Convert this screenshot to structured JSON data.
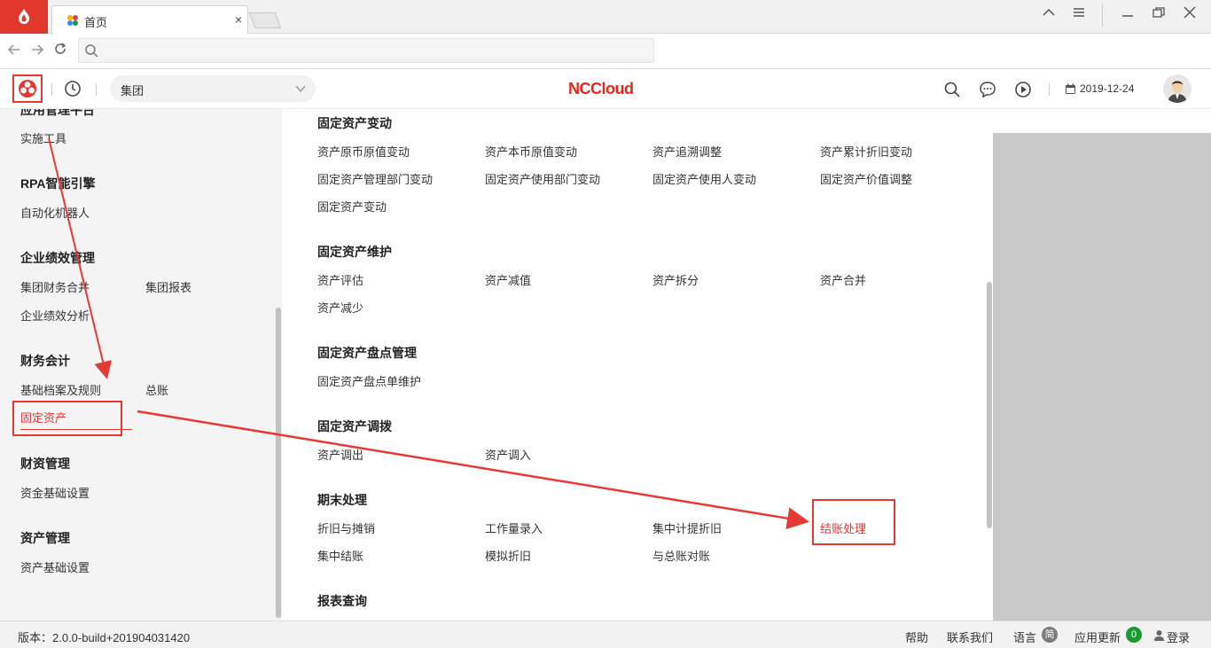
{
  "browser": {
    "tab_title": "首页",
    "tab_close": "×",
    "window_controls": [
      "▲",
      "≡",
      "—",
      "❐",
      "✕"
    ]
  },
  "header": {
    "group_selector": "集团",
    "brand": "NCCloud",
    "date": "2019-12-24"
  },
  "left_menu": {
    "categories": [
      {
        "title": "应用管理平台",
        "items": [
          "实施工具"
        ]
      },
      {
        "title": "RPA智能引擎",
        "items": [
          "自动化机器人"
        ]
      },
      {
        "title": "企业绩效管理",
        "items": [
          "集团财务合并",
          "集团报表",
          "企业绩效分析"
        ]
      },
      {
        "title": "财务会计",
        "items": [
          "基础档案及规则",
          "总账",
          "固定资产"
        ]
      },
      {
        "title": "财资管理",
        "items": [
          "资金基础设置"
        ]
      },
      {
        "title": "资产管理",
        "items": [
          "资产基础设置"
        ]
      }
    ],
    "active_item": "固定资产"
  },
  "main": {
    "sections": [
      {
        "title": "固定资产变动",
        "items": [
          "资产原币原值变动",
          "资产本币原值变动",
          "资产追溯调整",
          "资产累计折旧变动",
          "固定资产管理部门变动",
          "固定资产使用部门变动",
          "固定资产使用人变动",
          "固定资产价值调整",
          "固定资产变动"
        ]
      },
      {
        "title": "固定资产维护",
        "items": [
          "资产评估",
          "资产减值",
          "资产拆分",
          "资产合并",
          "资产减少"
        ]
      },
      {
        "title": "固定资产盘点管理",
        "items": [
          "固定资产盘点单维护"
        ]
      },
      {
        "title": "固定资产调拨",
        "items": [
          "资产调出",
          "资产调入"
        ]
      },
      {
        "title": "期末处理",
        "items": [
          "折旧与摊销",
          "工作量录入",
          "集中计提折旧",
          "结账处理",
          "集中结账",
          "模拟折旧",
          "与总账对账"
        ]
      },
      {
        "title": "报表查询",
        "items": []
      }
    ],
    "highlighted_item": "结账处理"
  },
  "footer": {
    "version": "版本：2.0.0-build+201904031420",
    "help": "帮助",
    "contact": "联系我们",
    "language": "语言",
    "language_badge": "简",
    "app_update": "应用更新",
    "update_count": "0",
    "login": "登录"
  },
  "colors": {
    "accent_red": "#e53935",
    "brand_red": "#e5261f",
    "menu_bg": "#f4f4f4",
    "update_badge_green": "#1a9a2e"
  }
}
